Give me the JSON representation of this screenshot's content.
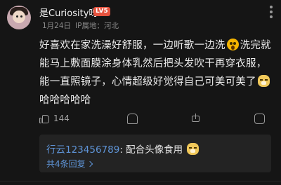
{
  "comment": {
    "username": "是Curiosity呀",
    "level_badge": "LV5",
    "date": "1月24日",
    "ip_location": "IP属地：河北",
    "body": {
      "segment1": "好喜欢在家洗澡好舒服，一边听歌一边洗",
      "emoji1": "scream-emoji",
      "segment2": "洗完就能马上敷面膜涂身体乳然后把头发吹干再穿衣服，能一直照镜子，心情超级好觉得自己可美可美了",
      "emoji2": "doge-emoji",
      "segment3": "哈哈哈哈哈"
    },
    "likes": "144"
  },
  "reply": {
    "author": "行云123456789",
    "text": ": 配合头像食用",
    "emoji": "doge-emoji",
    "count_label": "共4条回复"
  }
}
